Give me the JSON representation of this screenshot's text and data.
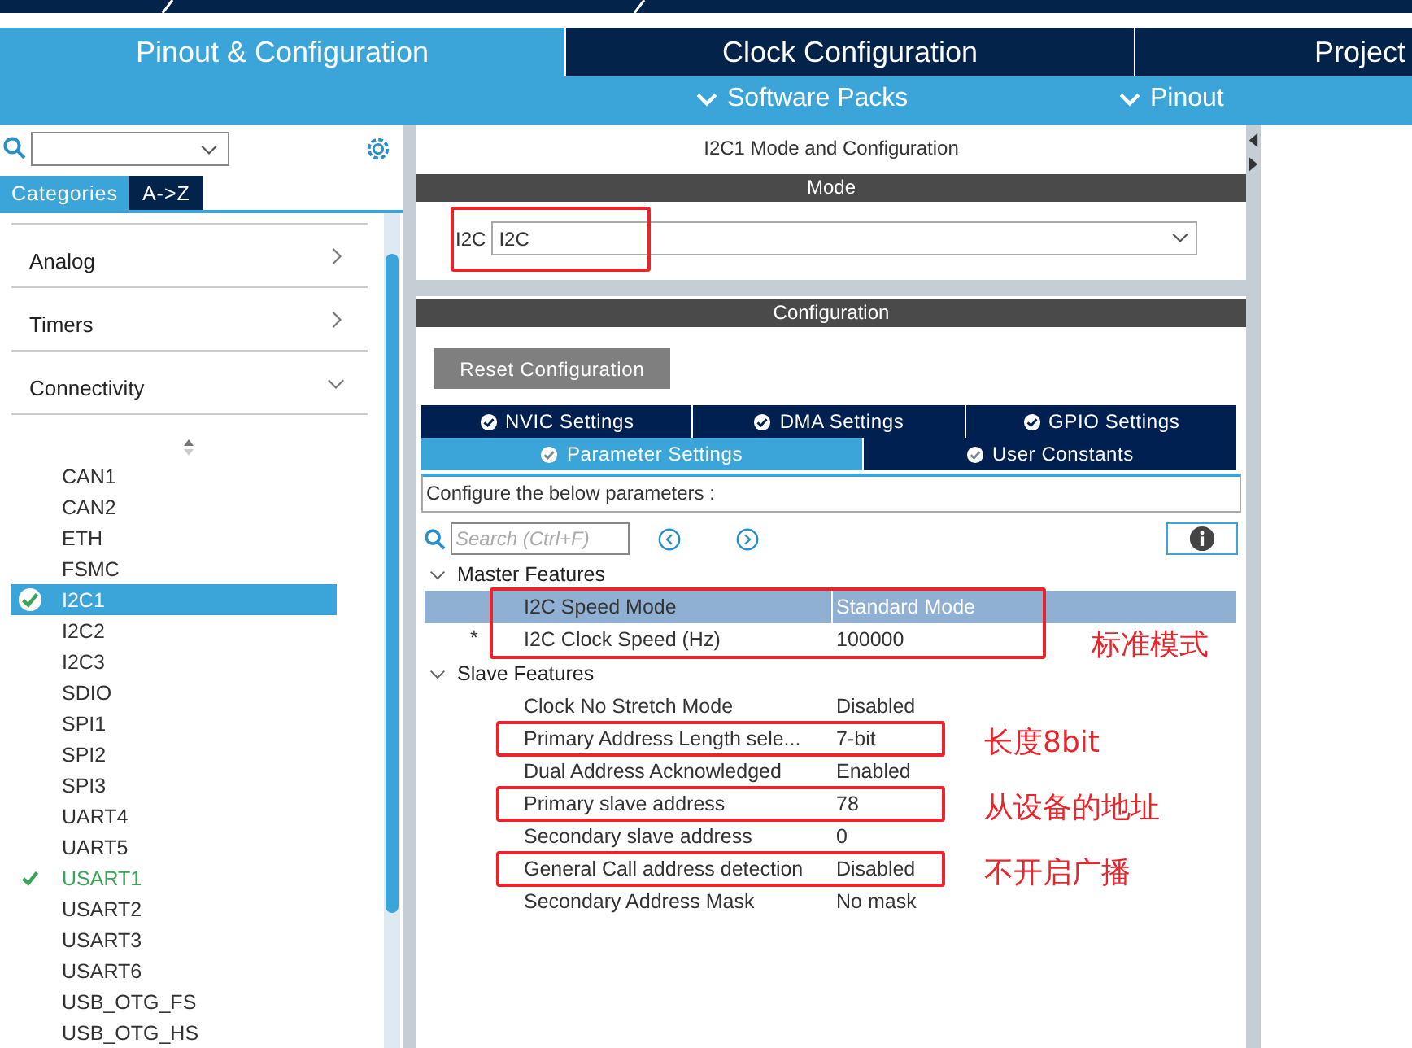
{
  "top_tabs": [
    {
      "label": "Pinout & Configuration",
      "selected": true
    },
    {
      "label": "Clock Configuration",
      "selected": false
    },
    {
      "label": "Project",
      "selected": false
    }
  ],
  "sub_menu": [
    "Software Packs",
    "Pinout"
  ],
  "left": {
    "view_tabs": [
      {
        "label": "Categories",
        "selected": true
      },
      {
        "label": "A->Z",
        "selected": false
      }
    ],
    "categories": [
      {
        "label": "Analog",
        "expanded": false
      },
      {
        "label": "Timers",
        "expanded": false
      },
      {
        "label": "Connectivity",
        "expanded": true
      }
    ],
    "peripherals": [
      {
        "label": "CAN1",
        "selected": false,
        "checked": false
      },
      {
        "label": "CAN2",
        "selected": false,
        "checked": false
      },
      {
        "label": "ETH",
        "selected": false,
        "checked": false
      },
      {
        "label": "FSMC",
        "selected": false,
        "checked": false
      },
      {
        "label": "I2C1",
        "selected": true,
        "checked": true
      },
      {
        "label": "I2C2",
        "selected": false,
        "checked": false
      },
      {
        "label": "I2C3",
        "selected": false,
        "checked": false
      },
      {
        "label": "SDIO",
        "selected": false,
        "checked": false
      },
      {
        "label": "SPI1",
        "selected": false,
        "checked": false
      },
      {
        "label": "SPI2",
        "selected": false,
        "checked": false
      },
      {
        "label": "SPI3",
        "selected": false,
        "checked": false
      },
      {
        "label": "UART4",
        "selected": false,
        "checked": false
      },
      {
        "label": "UART5",
        "selected": false,
        "checked": false
      },
      {
        "label": "USART1",
        "selected": false,
        "checked": true
      },
      {
        "label": "USART2",
        "selected": false,
        "checked": false
      },
      {
        "label": "USART3",
        "selected": false,
        "checked": false
      },
      {
        "label": "USART6",
        "selected": false,
        "checked": false
      },
      {
        "label": "USB_OTG_FS",
        "selected": false,
        "checked": false
      },
      {
        "label": "USB_OTG_HS",
        "selected": false,
        "checked": false
      }
    ]
  },
  "panel": {
    "title": "I2C1 Mode and Configuration",
    "mode_header": "Mode",
    "mode_label": "I2C",
    "mode_value": "I2C",
    "mode_boxed": true,
    "config_header": "Configuration",
    "reset_button": "Reset Configuration",
    "tabs_row1": [
      {
        "label": "NVIC Settings",
        "selected": false
      },
      {
        "label": "DMA Settings",
        "selected": false
      },
      {
        "label": "GPIO Settings",
        "selected": false
      }
    ],
    "tabs_row2": [
      {
        "label": "Parameter Settings",
        "selected": true
      },
      {
        "label": "User Constants",
        "selected": false
      }
    ],
    "params_caption": "Configure the below parameters :",
    "search_placeholder": "Search (Ctrl+F)",
    "sections": [
      {
        "title": "Master Features",
        "expanded": true,
        "boxed": true,
        "note": "标准模式",
        "rows": [
          {
            "label": "I2C Speed Mode",
            "value": "Standard Mode",
            "selected": true,
            "boxed": false
          },
          {
            "marker": "*",
            "label": "I2C Clock Speed (Hz)",
            "value": "100000",
            "selected": false,
            "boxed": false
          }
        ]
      },
      {
        "title": "Slave Features",
        "expanded": true,
        "rows": [
          {
            "label": "Clock No Stretch Mode",
            "value": "Disabled",
            "selected": false,
            "boxed": false
          },
          {
            "label": "Primary Address Length sele...",
            "value": "7-bit",
            "selected": false,
            "boxed": true,
            "note": "长度8bit"
          },
          {
            "label": "Dual Address Acknowledged",
            "value": "Enabled",
            "selected": false,
            "boxed": false
          },
          {
            "label": "Primary slave address",
            "value": "78",
            "selected": false,
            "boxed": true,
            "note": "从设备的地址"
          },
          {
            "label": "Secondary slave address",
            "value": "0",
            "selected": false,
            "boxed": false
          },
          {
            "label": "General Call address detection",
            "value": "Disabled",
            "selected": false,
            "boxed": true,
            "note": "不开启广播"
          },
          {
            "label": "Secondary Address Mask",
            "value": "No mask",
            "selected": false,
            "boxed": false
          }
        ]
      }
    ]
  }
}
